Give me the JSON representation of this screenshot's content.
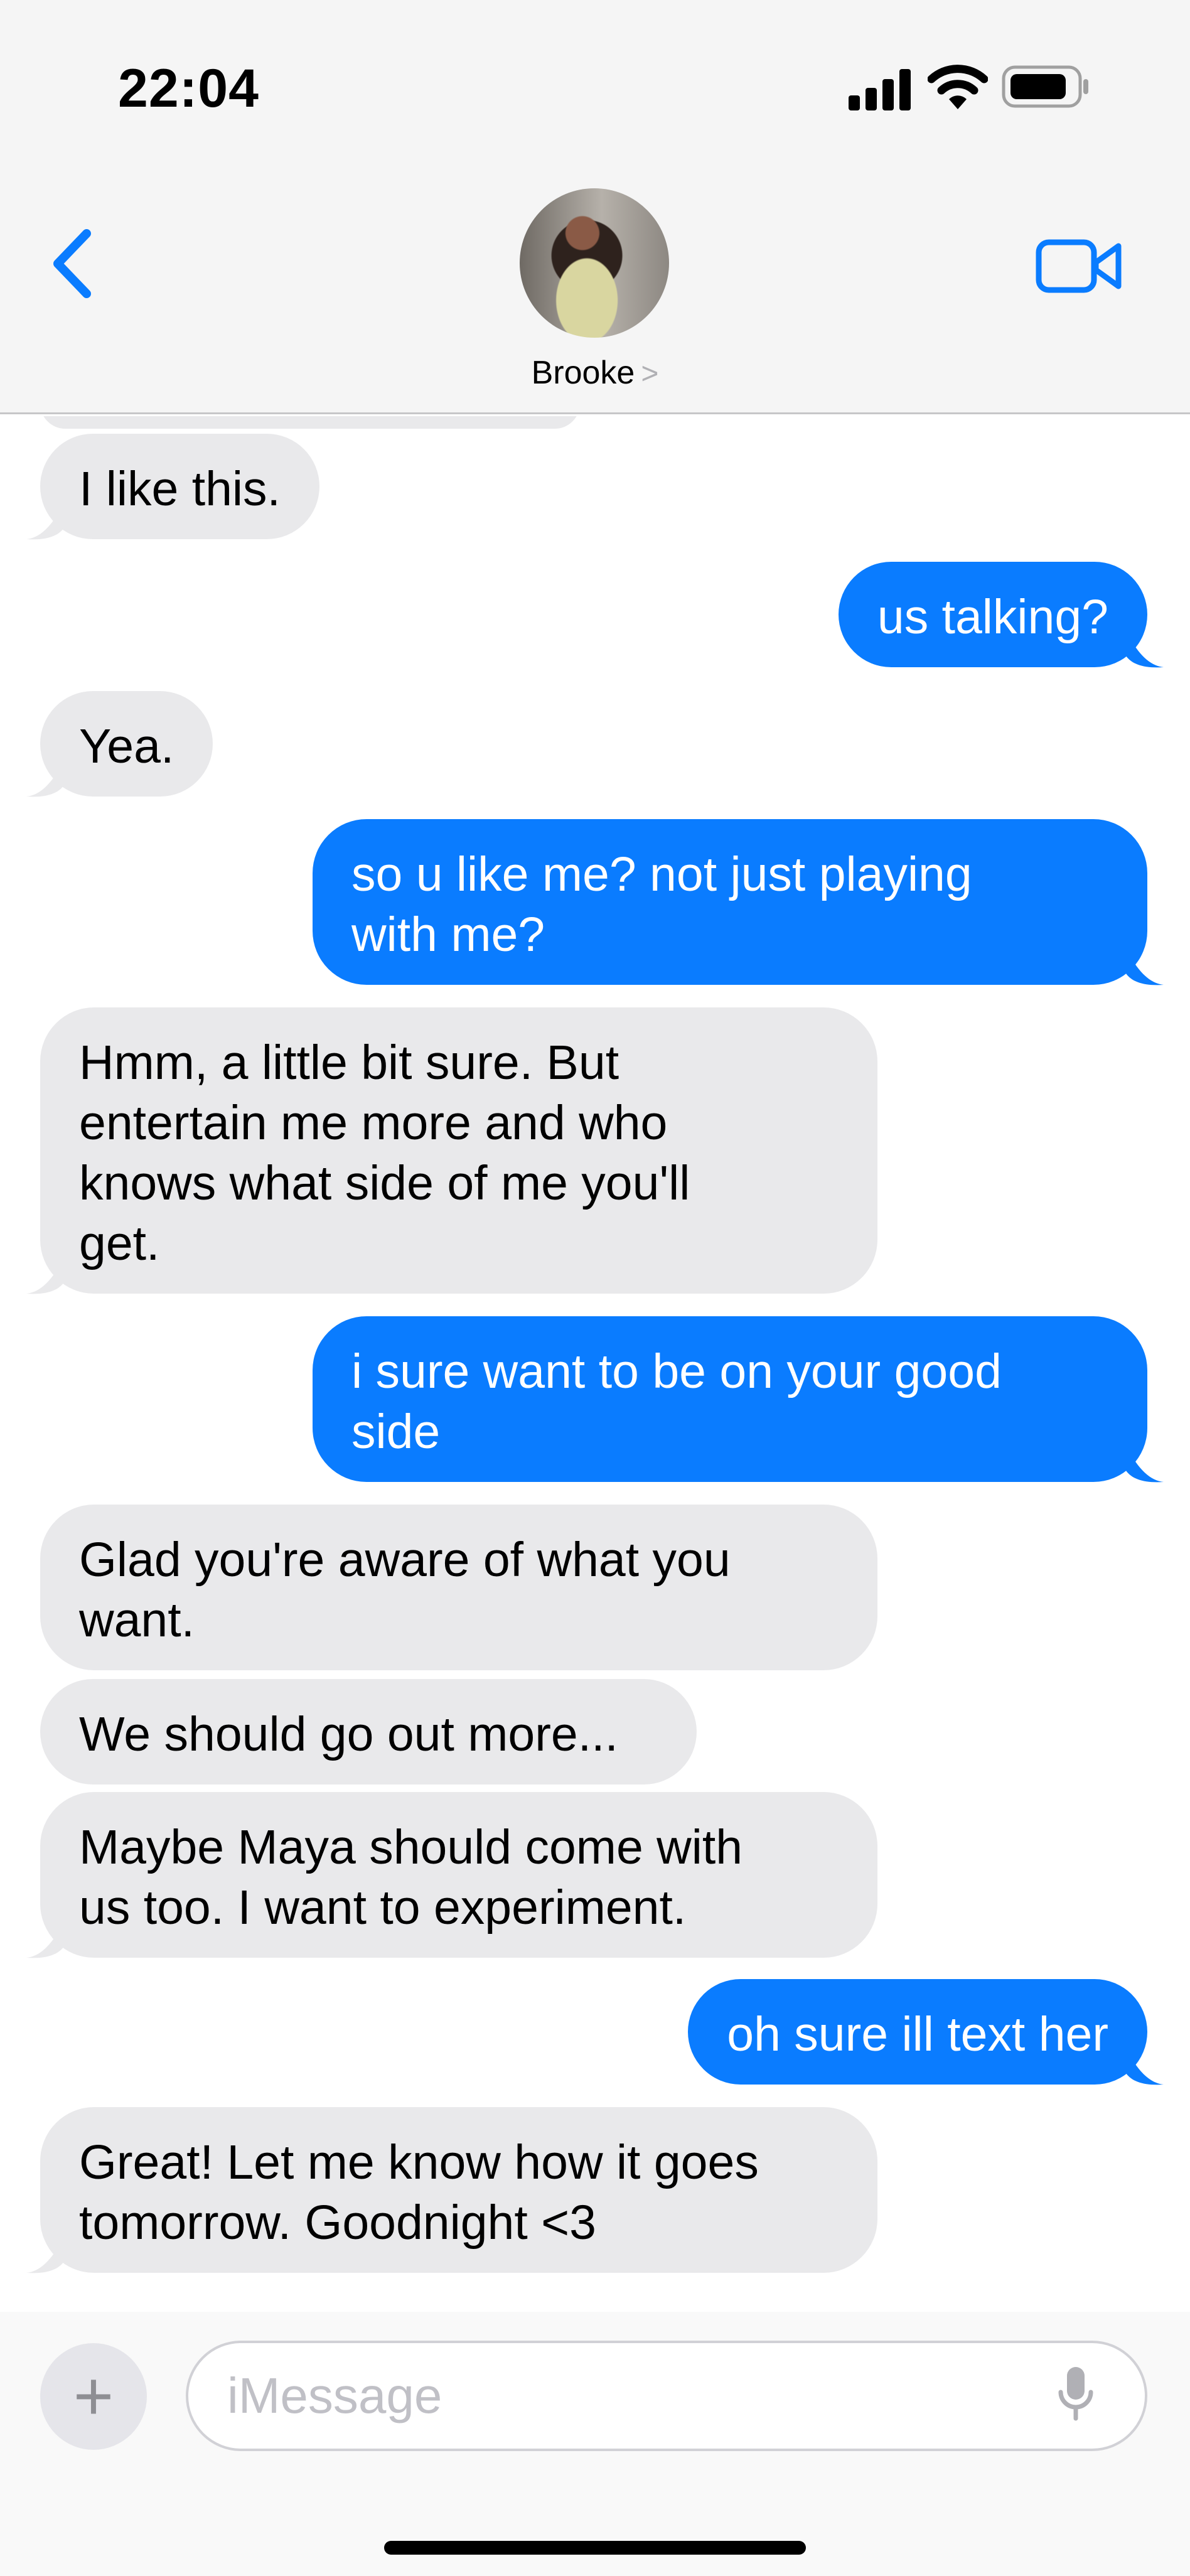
{
  "status_bar": {
    "time": "22:04"
  },
  "header": {
    "contact_name": "Brooke",
    "chevron": ">"
  },
  "messages": [
    {
      "from": "them",
      "text": "I like this."
    },
    {
      "from": "me",
      "text": "us talking?"
    },
    {
      "from": "them",
      "text": "Yea."
    },
    {
      "from": "me",
      "text": "so u like me? not just playing\nwith me?"
    },
    {
      "from": "them",
      "text": "Hmm, a little bit sure. But\nentertain me more and who\nknows what side of me you'll\nget."
    },
    {
      "from": "me",
      "text": "i sure want to be on your good\nside"
    },
    {
      "from": "them",
      "text": "Glad you're aware of what you\nwant."
    },
    {
      "from": "them",
      "text": "We should go out more..."
    },
    {
      "from": "them",
      "text": "Maybe Maya should come with\nus too. I want to experiment."
    },
    {
      "from": "me",
      "text": "oh sure ill text her"
    },
    {
      "from": "them",
      "text": "Great! Let me know how it goes\ntomorrow. Goodnight <3"
    }
  ],
  "composer": {
    "placeholder": "iMessage",
    "plus": "+"
  },
  "colors": {
    "outgoing": "#0a7cff",
    "incoming": "#e9e9eb",
    "accent": "#0a7cff"
  }
}
